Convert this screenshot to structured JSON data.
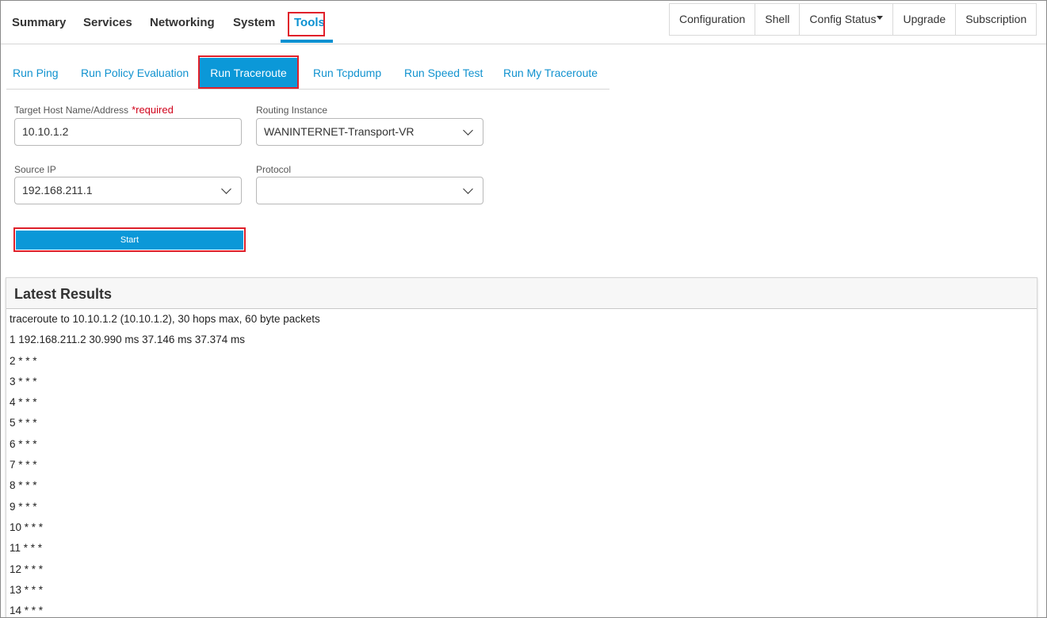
{
  "top_nav": {
    "tabs": [
      {
        "label": "Summary"
      },
      {
        "label": "Services"
      },
      {
        "label": "Networking"
      },
      {
        "label": "System"
      },
      {
        "label": "Tools"
      }
    ],
    "active_tab": "Tools",
    "right_buttons": [
      {
        "label": "Configuration"
      },
      {
        "label": "Shell"
      },
      {
        "label": "Config Status"
      },
      {
        "label": "Upgrade"
      },
      {
        "label": "Subscription"
      }
    ]
  },
  "sub_tabs": {
    "items": [
      {
        "label": "Run Ping"
      },
      {
        "label": "Run Policy Evaluation"
      },
      {
        "label": "Run Traceroute"
      },
      {
        "label": "Run Tcpdump"
      },
      {
        "label": "Run Speed Test"
      },
      {
        "label": "Run My Traceroute"
      }
    ],
    "active": "Run Traceroute"
  },
  "form": {
    "target_label": "Target Host Name/Address",
    "required_text": "*required",
    "target_value": "10.10.1.2",
    "routing_label": "Routing Instance",
    "routing_value": "WANINTERNET-Transport-VR",
    "source_label": "Source IP",
    "source_value": "192.168.211.1",
    "protocol_label": "Protocol",
    "protocol_value": "",
    "start_label": "Start"
  },
  "results": {
    "title": "Latest Results",
    "lines": [
      "traceroute to 10.10.1.2 (10.10.1.2), 30 hops max, 60 byte packets",
      "1 192.168.211.2 30.990 ms 37.146 ms 37.374 ms",
      "2 * * *",
      "3 * * *",
      "4 * * *",
      "5 * * *",
      "6 * * *",
      "7 * * *",
      "8 * * *",
      "9 * * *",
      "10 * * *",
      "11 * * *",
      "12 * * *",
      "13 * * *",
      "14 * * *"
    ]
  },
  "colors": {
    "accent": "#0b98d8",
    "highlight": "#e0202a",
    "required": "#d0021b"
  }
}
